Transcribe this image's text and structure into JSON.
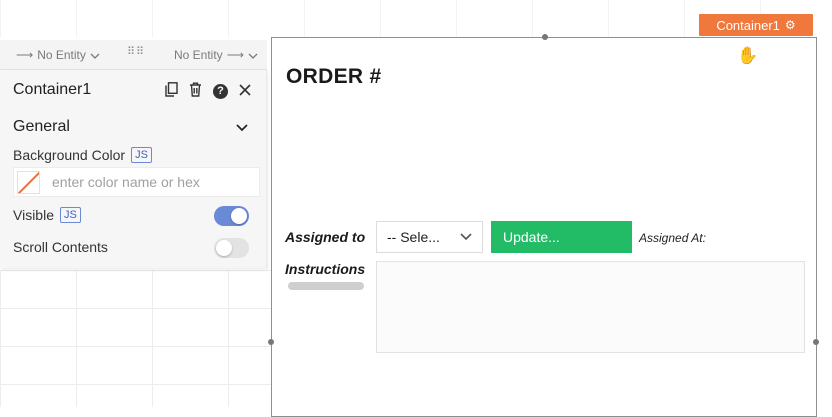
{
  "entity_bar": {
    "left_label": "No Entity",
    "right_label": "No Entity"
  },
  "widget_tag": {
    "label": "Container1",
    "icon": "gear-icon",
    "color": "#f0783c"
  },
  "property_pane": {
    "title": "Container1",
    "icons": [
      "copy-icon",
      "delete-icon",
      "help-icon",
      "close-icon"
    ],
    "section": "General",
    "background_color": {
      "label": "Background Color",
      "js_badge": "JS",
      "placeholder": "enter color name or hex"
    },
    "visible": {
      "label": "Visible",
      "js_badge": "JS",
      "enabled": true
    },
    "scroll_contents": {
      "label": "Scroll Contents",
      "enabled": false
    }
  },
  "container": {
    "title": "ORDER #",
    "assigned_to_label": "Assigned to",
    "select_value": "-- Sele...",
    "update_button": "Update...",
    "assigned_at_label": "Assigned At:",
    "instructions_label": "Instructions",
    "accent_green": "#22bb66"
  }
}
